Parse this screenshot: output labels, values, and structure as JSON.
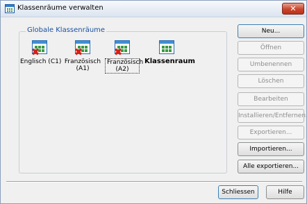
{
  "window": {
    "title": "Klassenräume verwalten",
    "close_label": "✕"
  },
  "group": {
    "legend": "Globale Klassenräume"
  },
  "rooms": [
    {
      "label": "Englisch (C1)",
      "status": "missing"
    },
    {
      "label": "Französisch (A1)",
      "status": "missing"
    },
    {
      "label": "Französisch (A2)",
      "status": "missing",
      "selected": true
    },
    {
      "label": "Klassenraum",
      "status": "ok",
      "bold": true
    }
  ],
  "buttons": {
    "neu": "Neu...",
    "oeffnen": "Öffnen",
    "umbenennen": "Umbenennen",
    "loeschen": "Löschen",
    "bearbeiten": "Bearbeiten",
    "installieren": "Installieren/Entfernen...",
    "exportieren": "Exportieren...",
    "importieren": "Importieren...",
    "alle_exportieren": "Alle exportieren...",
    "schliessen": "Schliessen",
    "hilfe": "Hilfe"
  },
  "colors": {
    "legend_text": "#1a4fa0",
    "missing_mark": "#d3211a",
    "disabled_text": "#8c8c8c"
  }
}
